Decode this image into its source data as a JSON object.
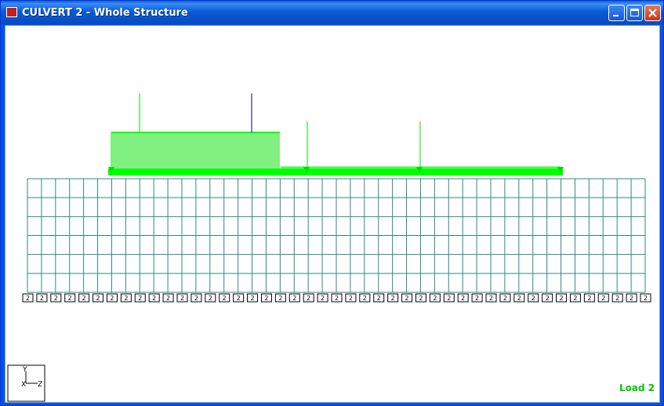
{
  "window": {
    "title": "CULVERT 2 - Whole Structure"
  },
  "status": {
    "load_label": "Load 2"
  },
  "axes": {
    "y_label": "Y",
    "x_label": "X",
    "z_label": "Z"
  },
  "support_tag_label": "2",
  "colors": {
    "mesh": "#2e8b7a",
    "load": "#00e000",
    "load_bright": "#00ff00",
    "load_marker": "#00008b",
    "load_text": "#00c800"
  }
}
